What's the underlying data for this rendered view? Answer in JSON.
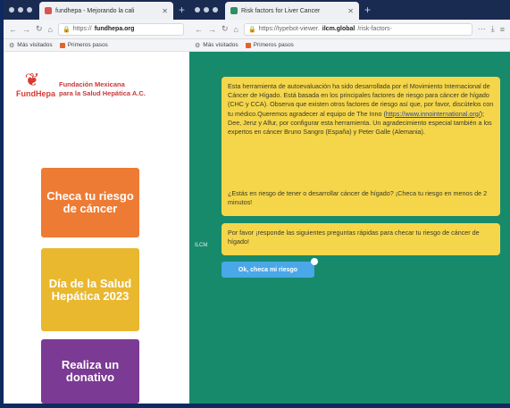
{
  "left_window": {
    "tab_title": "fundhepa - Mejorando la cali",
    "url_prefix": "https://",
    "url_domain": "fundhepa.org",
    "bookmarks": [
      "Más visitados",
      "Primeros pasos"
    ],
    "logo_text": "FundHepa",
    "foundation_line1": "Fundación Mexicana",
    "foundation_line2": "para la Salud Hepática A.C.",
    "tiles": [
      {
        "text": "Checa tu riesgo de cáncer",
        "color": "#ee7b34"
      },
      {
        "text": "Día de la Salud Hepática 2023",
        "color": "#e9b82f"
      },
      {
        "text": "Realiza un donativo",
        "color": "#7b3a93"
      }
    ]
  },
  "right_window": {
    "tab_title": "Risk factors for Liver Cancer",
    "url_prefix": "https://typebot-viewer.",
    "url_domain": "ilcm.global",
    "url_suffix": "/risk-factors-",
    "bookmarks": [
      "Más visitados",
      "Primeros pasos"
    ],
    "side_label": "ILCM",
    "bubble1_part1": "Esta herramienta de autoevaluación ha sido desarrollada por el Movimiento Internacional de Cáncer de Hígado. Está basada en los principales factores de riesgo para cáncer de hígado (CHC y CCA). Observa que existen otros factores de riesgo así que, por favor, discútelos con tu médico.Queremos agradecer al equipo de The Inno (",
    "bubble1_link": "https://www.innointernational.org/",
    "bubble1_part2": "); Dee, Jenz y Alfur, por configurar esta herramienta. Un agradecimiento especial también a los expertos en cáncer Bruno Sangro (España) y Peter Galle (Alemania).",
    "bubble2": "¿Estás en riesgo de tener o desarrollar cáncer de hígado? ¡Checa tu riesgo en menos de 2 minutos!",
    "bubble3": "Por favor ¡responde las siguientes preguntas rápidas para checar tu riesgo de cáncer de hígado!",
    "button": "Ok, checa mi riesgo"
  },
  "colors": {
    "background": "#0e2a5f",
    "chat_bg": "#178a6c",
    "bubble": "#f5d64a",
    "button": "#4aa7e8"
  }
}
